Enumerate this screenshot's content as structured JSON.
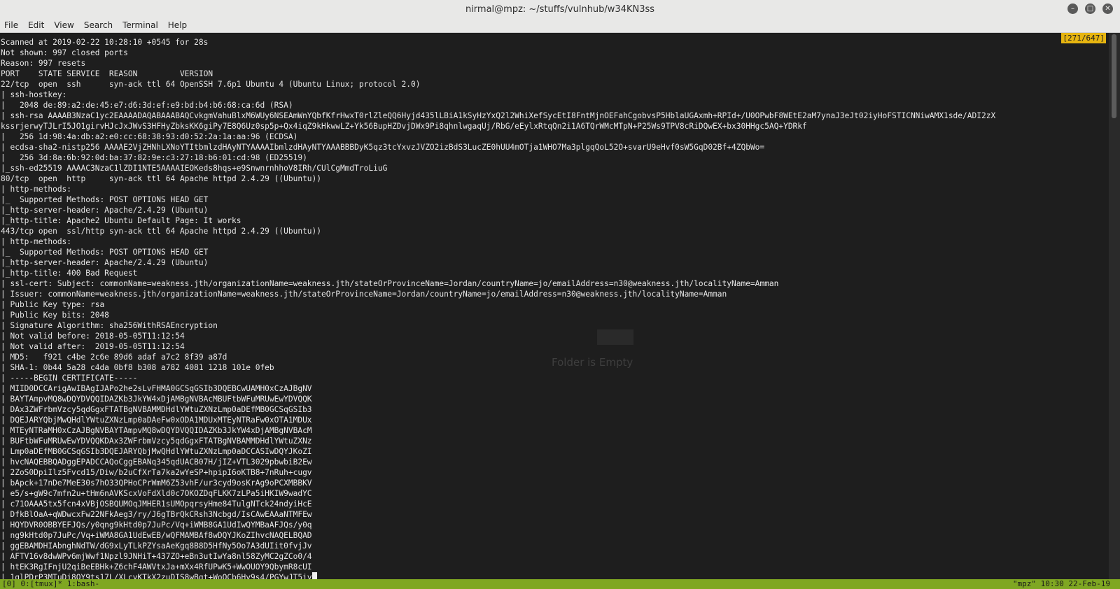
{
  "window": {
    "title": "nirmal@mpz: ~/stuffs/vulnhub/w34KN3ss",
    "controls": [
      "minimize-icon",
      "maximize-icon",
      "close-icon"
    ]
  },
  "menu": [
    "File",
    "Edit",
    "View",
    "Search",
    "Terminal",
    "Help"
  ],
  "terminal": {
    "pane_counter": "[271/647]",
    "lines": [
      "Scanned at 2019-02-22 10:28:10 +0545 for 28s",
      "Not shown: 997 closed ports",
      "Reason: 997 resets",
      "PORT    STATE SERVICE  REASON         VERSION",
      "22/tcp  open  ssh      syn-ack ttl 64 OpenSSH 7.6p1 Ubuntu 4 (Ubuntu Linux; protocol 2.0)",
      "| ssh-hostkey:",
      "|   2048 de:89:a2:de:45:e7:d6:3d:ef:e9:bd:b4:b6:68:ca:6d (RSA)",
      "| ssh-rsa AAAAB3NzaC1yc2EAAAADAQABAAABAQCvkgmVahuBlxM6WUy6NSEAmWnYQbfKfrHwxT0rlZleQQ6Hyjd435lLBiA1kSyHzYxQ2l2WhiXefSycEtI8FntMjnOEFahCgobvsP5HblaUGAxmh+RPId+/U0OPwbF8WEtE2aM7ynaJ3eJt02iyHoFSTICNNiwAMX1sde/ADI2zX",
      "kssrjerwyTJLrI5JO1girvHJcJxJWvS3HFHyZbksKK6giPy7E8Q6Uz0sp5p+Qx4iqZ9kHkwwLZ+Yk56BupHZDvjDWx9Pi8qhnlwgaqUj/RbG/eEylxRtqQn2i1A6TQrWMcMTpN+P25Ws9TPV8cRiDQwEX+bx30HHgc5AQ+YDRkf",
      "|   256 1d:98:4a:db:a2:e0:cc:68:38:93:d0:52:2a:1a:aa:96 (ECDSA)",
      "| ecdsa-sha2-nistp256 AAAAE2VjZHNhLXNoYTItbmlzdHAyNTYAAAAIbmlzdHAyNTYAAABBBDyK5qz3tcYxvzJVZO2izBdS3LucZE0hUU4mOTja1WHO7Ma3plgqQoL52O+svarU9eHvf0sW5GqD02Bf+4ZQbWo=",
      "|   256 3d:8a:6b:92:0d:ba:37:82:9e:c3:27:18:b6:01:cd:98 (ED25519)",
      "|_ssh-ed25519 AAAAC3NzaC1lZDI1NTE5AAAAIEOKeds8hqs+e9SnwnrnhhoV8IRh/CUlCgMmdTroLiuG",
      "80/tcp  open  http     syn-ack ttl 64 Apache httpd 2.4.29 ((Ubuntu))",
      "| http-methods:",
      "|_  Supported Methods: POST OPTIONS HEAD GET",
      "|_http-server-header: Apache/2.4.29 (Ubuntu)",
      "|_http-title: Apache2 Ubuntu Default Page: It works",
      "443/tcp open  ssl/http syn-ack ttl 64 Apache httpd 2.4.29 ((Ubuntu))",
      "| http-methods:",
      "|_  Supported Methods: POST OPTIONS HEAD GET",
      "|_http-server-header: Apache/2.4.29 (Ubuntu)",
      "|_http-title: 400 Bad Request",
      "| ssl-cert: Subject: commonName=weakness.jth/organizationName=weakness.jth/stateOrProvinceName=Jordan/countryName=jo/emailAddress=n30@weakness.jth/localityName=Amman",
      "| Issuer: commonName=weakness.jth/organizationName=weakness.jth/stateOrProvinceName=Jordan/countryName=jo/emailAddress=n30@weakness.jth/localityName=Amman",
      "| Public Key type: rsa",
      "| Public Key bits: 2048",
      "| Signature Algorithm: sha256WithRSAEncryption",
      "| Not valid before: 2018-05-05T11:12:54",
      "| Not valid after:  2019-05-05T11:12:54",
      "| MD5:   f921 c4be 2c6e 89d6 adaf a7c2 8f39 a87d",
      "| SHA-1: 0b44 5a28 c4da 0bf8 b308 a782 4081 1218 101e 0feb",
      "| -----BEGIN CERTIFICATE-----",
      "| MIID0DCCArigAwIBAgIJAPo2he2sLvFHMA0GCSqGSIb3DQEBCwUAMH0xCzAJBgNV",
      "| BAYTAmpvMQ8wDQYDVQQIDAZKb3JkYW4xDjAMBgNVBAcMBUFtbWFuMRUwEwYDVQQK",
      "| DAx3ZWFrbmVzcy5qdGgxFTATBgNVBAMMDHdlYWtuZXNzLmp0aDEfMB0GCSqGSIb3",
      "| DQEJARYQbjMwQHdlYWtuZXNzLmp0aDAeFw0xODA1MDUxMTEyNTRaFw0xOTA1MDUx",
      "| MTEyNTRaMH0xCzAJBgNVBAYTAmpvMQ8wDQYDVQQIDAZKb3JkYW4xDjAMBgNVBAcM",
      "| BUFtbWFuMRUwEwYDVQQKDAx3ZWFrbmVzcy5qdGgxFTATBgNVBAMMDHdlYWtuZXNz",
      "| Lmp0aDEfMB0GCSqGSIb3DQEJARYQbjMwQHdlYWtuZXNzLmp0aDCCASIwDQYJKoZI",
      "| hvcNAQEBBQADggEPADCCAQoCggEBANq345qdUACB07H/jIZ+VTL3029pbwbiB2Ew",
      "| 2ZoS0DpiIlz5Fvcd15/Diw/b2uCfXrTa7ka2wYeSP+hpipI6oKTB8+7nRuh+cugv",
      "| bApck+17nDe7MeE30s7hO33QPHoCPrWmM6Z53vhF/ur3cyd9osKrAg9oPCXMBBKV",
      "| e5/s+gW9c7mfn2u+tHm6nAVKScxVoFdXld0c7OKOZDqFLKK7zLPa5iHKIW9wadYC",
      "| c71OAAA5tx5fcn4xVBjOSBQUMOqJMHER1sUMOpqrsyHme84TulgNTck24ndyiHcE",
      "| DfkBlOaA+qWDwcxFw22NFkAeg3/ry/J6gTBrQkCRsh3Ncbgd/IsCAwEAAaNTMFEw",
      "| HQYDVR0OBBYEFJQs/y0qng9kHtd0p7JuPc/Vq+iWMB8GA1UdIwQYMBaAFJQs/y0q",
      "| ng9kHtd0p7JuPc/Vq+iWMA8GA1UdEwEB/wQFMAMBAf8wDQYJKoZIhvcNAQELBQAD",
      "| ggEBAMDHIAbnghNdTW/dG9xLyTLkPZYsaAeKgq8B8D5HfNy5Oo7A3dUIit0fvjJv",
      "| AFTV16v8dwWPv6mjWwf1Npzl9JNHiT+437ZO+eBn3utIwYa8nl58ZyMC2gZCo0/4",
      "| htEK3RgIFnjU2qiBeEBHk+Z6chF4AWVtxJa+mXx4RfUPwK5+WwOUOY9QbymR8cUI",
      "| 1qlPDrP3MTuDj8OY9ts17L/XLcyKTkX2zuDIS8wBgt+WoOCb6Hy9s4/PGYwJT5iy"
    ]
  },
  "ghost": {
    "empty_text": "Folder is Empty"
  },
  "tmux": {
    "left": "[0] 0:[tmux]* 1:bash-",
    "right": "\"mpz\" 10:30 22-Feb-19"
  },
  "colors": {
    "tmux_bar": "#7fa722",
    "pane_counter": "#e7b510",
    "terminal_bg": "#1e1e1e"
  }
}
